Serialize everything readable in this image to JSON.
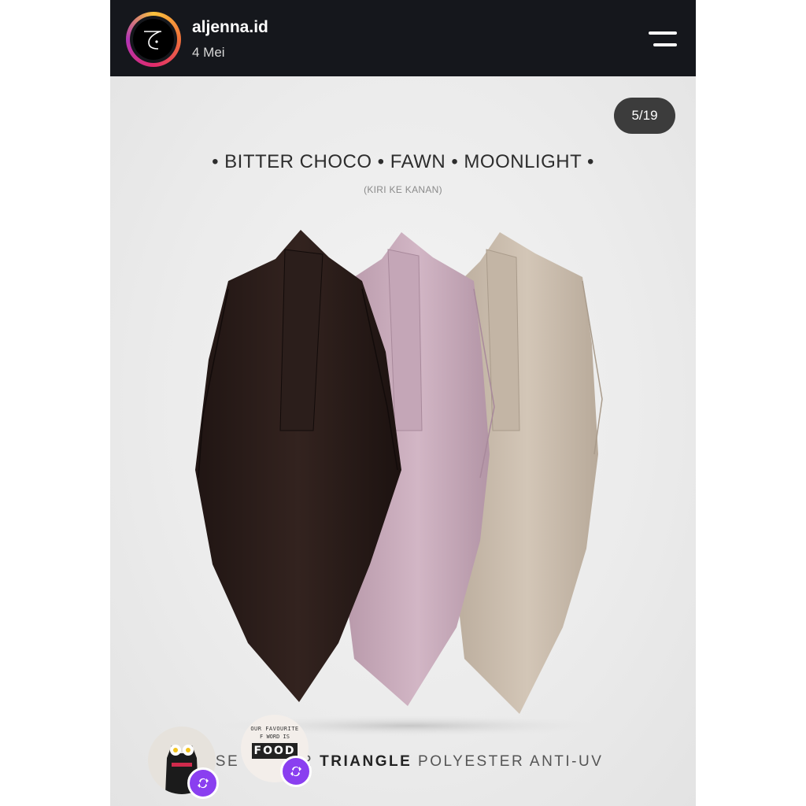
{
  "header": {
    "account_name": "aljenna.id",
    "post_date": "4 Mei",
    "menu_icon": "hamburger-menu-icon"
  },
  "post": {
    "counter": "5/19",
    "headline": "• BITTER CHOCO • FAWN • MOONLIGHT •",
    "subline": "(KIRI KE KANAN)",
    "caption_prefix": "USE",
    "caption_mid": "R ",
    "caption_bold": "TRIANGLE",
    "caption_suffix": " POLYESTER ANTI-UV",
    "swatches": [
      {
        "name": "BITTER CHOCO",
        "color": "#2a1d1b"
      },
      {
        "name": "FAWN",
        "color": "#c8a9ba"
      },
      {
        "name": "MOONLIGHT",
        "color": "#c9bcac"
      }
    ]
  },
  "overlays": {
    "avatar_1_icon": "cat-with-flowers-avatar",
    "avatar_2_text_top": "OUR FAVOURITE",
    "avatar_2_text_mid": "F WORD IS",
    "avatar_2_text_main": "FOOD",
    "repost_icon": "repost-icon"
  },
  "colors": {
    "topbar": "#15171c",
    "badge": "#8a3ff0"
  }
}
